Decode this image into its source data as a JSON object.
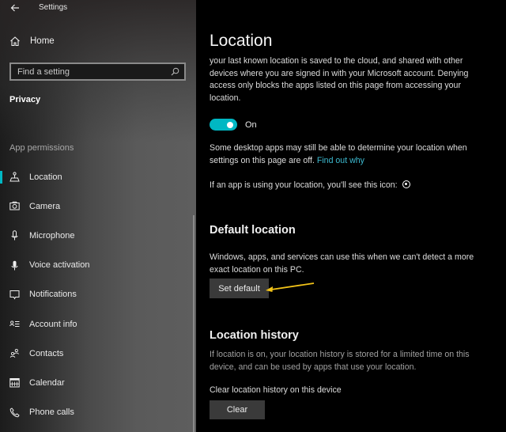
{
  "window": {
    "title": "Settings",
    "back_icon": "back-arrow-icon"
  },
  "sidebar": {
    "home_label": "Home",
    "home_icon": "home-icon",
    "search": {
      "placeholder": "Find a setting",
      "value": "",
      "icon": "search-icon"
    },
    "section_title": "Privacy",
    "group_label": "App permissions",
    "items": [
      {
        "label": "Location",
        "icon": "location-icon",
        "active": true
      },
      {
        "label": "Camera",
        "icon": "camera-icon",
        "active": false
      },
      {
        "label": "Microphone",
        "icon": "microphone-icon",
        "active": false
      },
      {
        "label": "Voice activation",
        "icon": "voice-activation-icon",
        "active": false
      },
      {
        "label": "Notifications",
        "icon": "notifications-icon",
        "active": false
      },
      {
        "label": "Account info",
        "icon": "account-info-icon",
        "active": false
      },
      {
        "label": "Contacts",
        "icon": "contacts-icon",
        "active": false
      },
      {
        "label": "Calendar",
        "icon": "calendar-icon",
        "active": false
      },
      {
        "label": "Phone calls",
        "icon": "phone-icon",
        "active": false
      }
    ]
  },
  "main": {
    "title": "Location",
    "intro": "your last known location is saved to the cloud, and shared with other devices where you are signed in with your Microsoft account. Denying access only blocks the apps listed on this page from accessing your location.",
    "toggle": {
      "state": "On",
      "on": true
    },
    "desktop_apps_note": "Some desktop apps may still be able to determine your location when settings on this page are off.",
    "find_out_why": "Find out why",
    "icon_note": "If an app is using your location, you'll see this icon:",
    "default_location": {
      "heading": "Default location",
      "description": "Windows, apps, and services can use this when we can't detect a more exact location on this PC.",
      "button": "Set default"
    },
    "location_history": {
      "heading": "Location history",
      "description": "If location is on, your location history is stored for a limited time on this device, and can be used by apps that use your location.",
      "clear_label": "Clear location history on this device",
      "button": "Clear"
    }
  },
  "colors": {
    "accent": "#00b7c3",
    "link": "#3dbad0",
    "annotation_arrow": "#f2c318",
    "button_bg": "#3a3a3a"
  }
}
